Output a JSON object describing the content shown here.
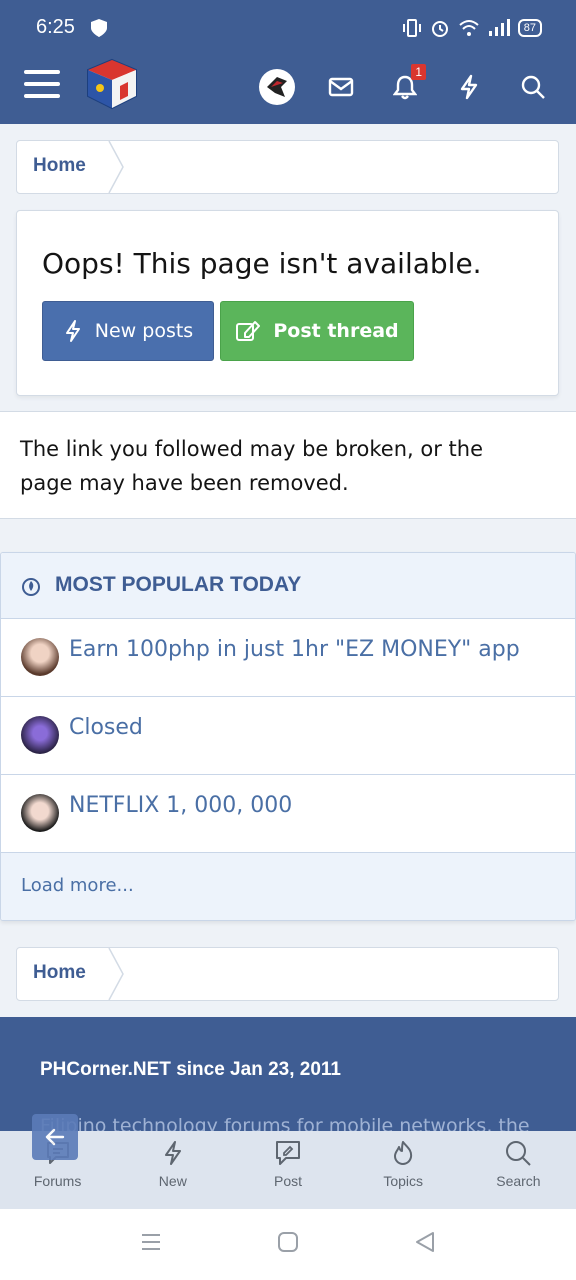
{
  "status_bar": {
    "time": "6:25",
    "battery": "87"
  },
  "header": {
    "menu_icon": "hamburger-icon",
    "logo_icon": "phcorner-logo",
    "notification_count": "1",
    "colors": {
      "header_bg": "#3f5d93",
      "badge": "#d9362f"
    }
  },
  "breadcrumb_top": {
    "label": "Home"
  },
  "error": {
    "title": "Oops! This page isn't available.",
    "new_posts_label": "New posts",
    "post_thread_label": "Post thread",
    "colors": {
      "new_posts": "#4a6fad",
      "post_thread": "#5bb55b"
    }
  },
  "message": {
    "text": "The link you followed may be broken, or the page may have been removed."
  },
  "popular": {
    "heading": "MOST POPULAR TODAY",
    "items": [
      {
        "title": "Earn 100php in just 1hr \"EZ MONEY\" app"
      },
      {
        "title": "Closed"
      },
      {
        "title": "NETFLIX 1, 000, 000"
      }
    ],
    "load_more": "Load more..."
  },
  "breadcrumb_bottom": {
    "label": "Home"
  },
  "footer": {
    "since": "PHCorner.NET since Jan 23, 2011",
    "description": "Filipino technology forums for mobile networks, the"
  },
  "bottom_nav": {
    "items": [
      {
        "label": "Forums",
        "icon": "forums-icon"
      },
      {
        "label": "New",
        "icon": "lightning-icon"
      },
      {
        "label": "Post",
        "icon": "post-icon"
      },
      {
        "label": "Topics",
        "icon": "fire-icon"
      },
      {
        "label": "Search",
        "icon": "search-icon"
      }
    ]
  }
}
